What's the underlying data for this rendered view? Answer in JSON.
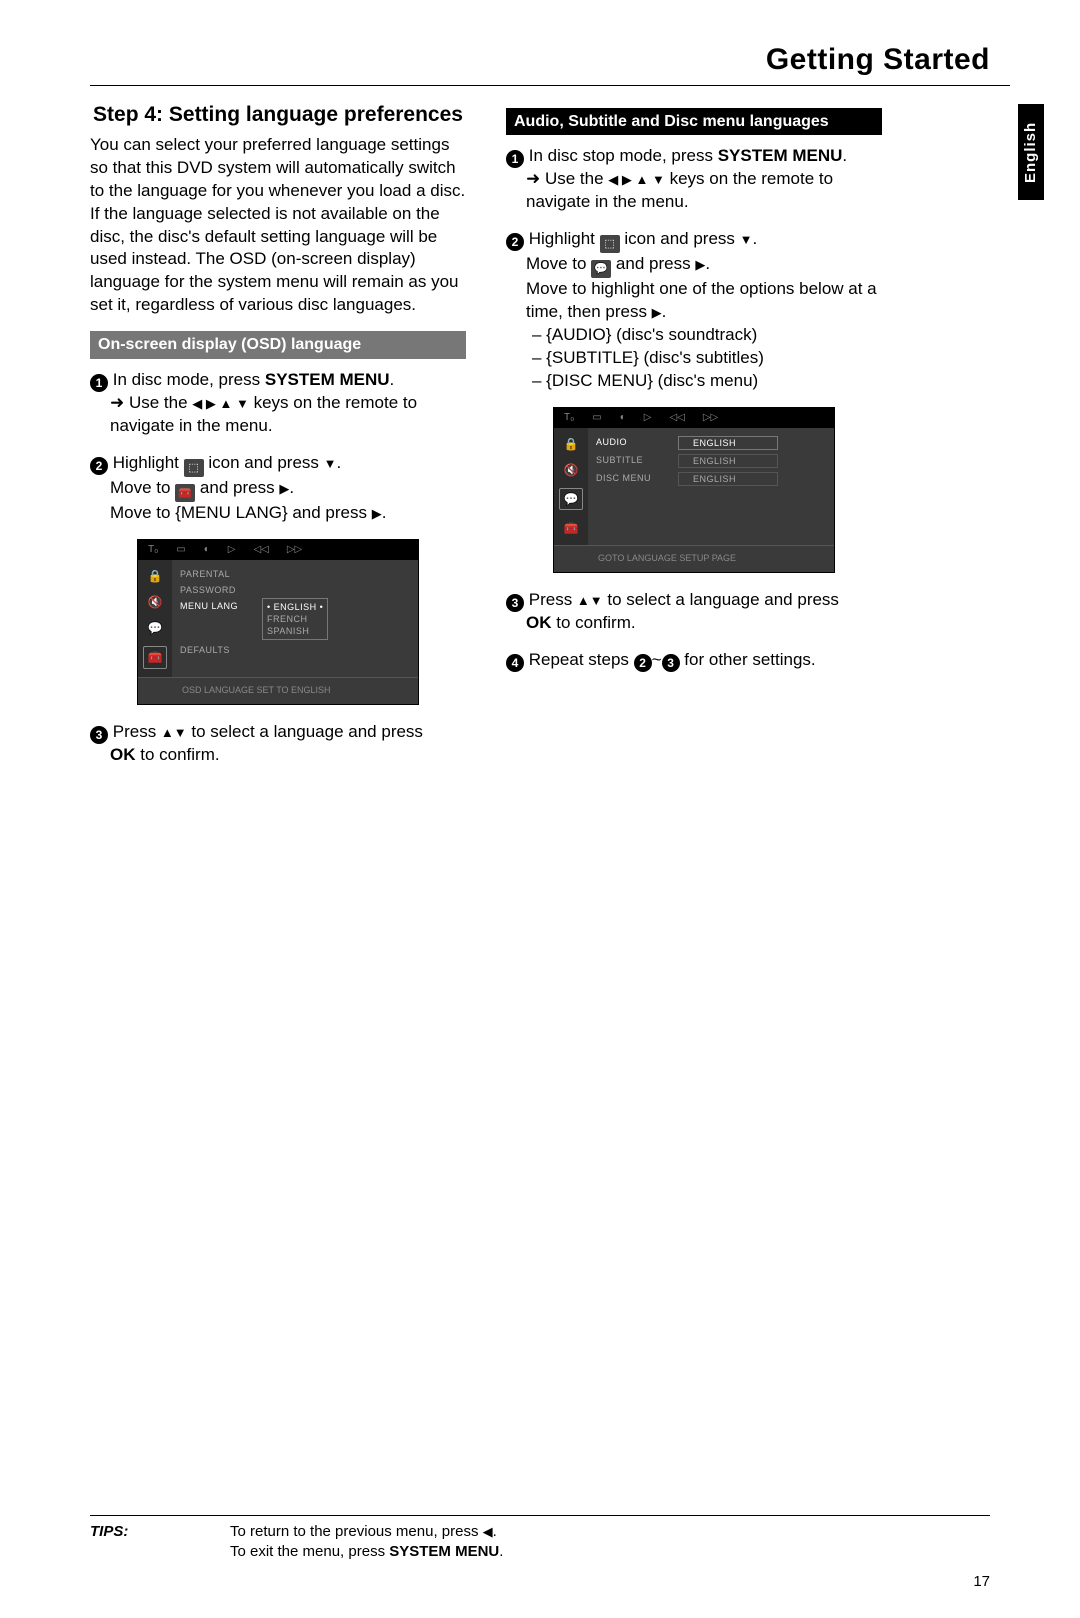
{
  "page_title": "Getting Started",
  "lang_tab": "English",
  "page_number": "17",
  "left": {
    "heading": "Step 4:  Setting language preferences",
    "intro": "You can select your preferred language settings so that this DVD system will automatically switch to the language for you whenever you load a disc.  If the language selected is not available on the disc, the disc's default setting language will be used instead.  The OSD (on-screen display) language for the system menu will remain as you set it, regardless of various disc languages.",
    "section": "On-screen display (OSD) language",
    "s1a": "In disc mode, press ",
    "s1b": "SYSTEM MENU",
    "s1c": ".",
    "s1_arrow_a": "Use the ",
    "s1_arrow_b": " keys on the remote to navigate in the menu.",
    "s2a": "Highlight ",
    "s2b": " icon and press ",
    "s2c": "Move to ",
    "s2d": " and press ",
    "s2e": "Move to {MENU LANG} and press ",
    "ss": {
      "rows": [
        "PARENTAL",
        "PASSWORD",
        "MENU LANG",
        "DEFAULTS"
      ],
      "langs": [
        "ENGLISH",
        "FRENCH",
        "SPANISH"
      ],
      "footer": "OSD LANGUAGE SET TO ENGLISH"
    },
    "s3a": "Press ",
    "s3b": " to select a language and press ",
    "s3c": "OK",
    "s3d": " to confirm."
  },
  "right": {
    "section": "Audio, Subtitle and Disc menu languages",
    "s1a": "In disc stop mode, press ",
    "s1b": "SYSTEM MENU",
    "s1c": ".",
    "s1_arrow_a": "Use the ",
    "s1_arrow_b": " keys on the remote to navigate in the menu.",
    "s2a": "Highlight ",
    "s2b": " icon and press ",
    "s2c": "Move to ",
    "s2d": " and press ",
    "s2e": "Move to highlight one of the options below at a time, then press ",
    "opts": [
      "– {AUDIO} (disc's soundtrack)",
      "– {SUBTITLE} (disc's subtitles)",
      "– {DISC MENU} (disc's menu)"
    ],
    "ss": {
      "rows": [
        "AUDIO",
        "SUBTITLE",
        "DISC MENU"
      ],
      "val": "ENGLISH",
      "footer": "GOTO LANGUAGE SETUP PAGE"
    },
    "s3a": "Press ",
    "s3b": " to select a language and press ",
    "s3c": "OK",
    "s3d": " to confirm.",
    "s4a": "Repeat steps ",
    "s4b": "~",
    "s4c": " for other settings."
  },
  "tips": {
    "label": "TIPS:",
    "line1a": "To return to the previous menu, press ",
    "line1b": ".",
    "line2a": "To exit the menu, press ",
    "line2b": "SYSTEM MENU",
    "line2c": "."
  }
}
